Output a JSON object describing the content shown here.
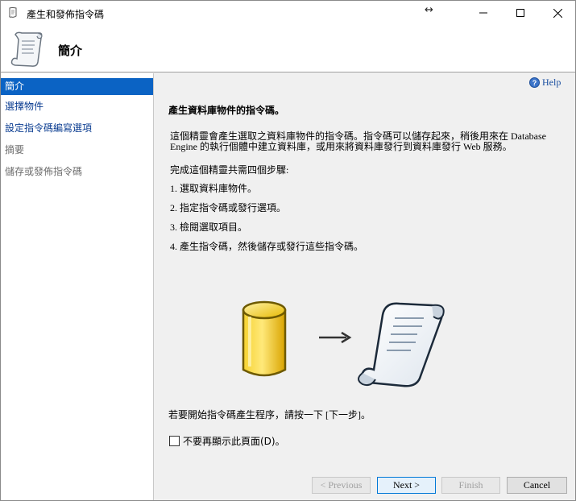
{
  "window": {
    "title": "產生和發佈指令碼",
    "resize_glyph": "↔"
  },
  "header": {
    "title": "簡介"
  },
  "sidebar": {
    "items": [
      {
        "label": "簡介",
        "state": "active"
      },
      {
        "label": "選擇物件",
        "state": "link"
      },
      {
        "label": "設定指令碼編寫選項",
        "state": "link"
      },
      {
        "label": "摘要",
        "state": "disabled"
      },
      {
        "label": "儲存或發佈指令碼",
        "state": "disabled"
      }
    ]
  },
  "main": {
    "help_label": "Help",
    "help_glyph": "?",
    "heading": "產生資料庫物件的指令碼。",
    "intro_line1": "這個精靈會產生選取之資料庫物件的指令碼。指令碼可以儲存起來，稍後用來在 Database",
    "intro_line2": "Engine 的執行個體中建立資料庫，或用來將資料庫發行到資料庫發行 Web 服務。",
    "steps_intro": "完成這個精靈共需四個步驟:",
    "steps": [
      "1. 選取資料庫物件。",
      "2. 指定指令碼或發行選項。",
      "3. 檢閱選取項目。",
      "4. 產生指令碼，然後儲存或發行這些指令碼。"
    ],
    "start_hint": "若要開始指令碼產生程序，請按一下 [下一步]。",
    "dont_show_label": "不要再顯示此頁面(D)。",
    "dont_show_checked": false
  },
  "buttons": {
    "previous": "< Previous",
    "next": "Next >",
    "finish": "Finish",
    "cancel": "Cancel"
  },
  "icons": {
    "app": "script-scroll-icon",
    "header": "script-scroll-icon",
    "database": "database-icon",
    "arrow": "arrow-right-icon",
    "scroll": "script-scroll-icon"
  },
  "colors": {
    "sidebar_active": "#0b63c4",
    "link": "#0b3d91",
    "database": "#f2c200"
  }
}
